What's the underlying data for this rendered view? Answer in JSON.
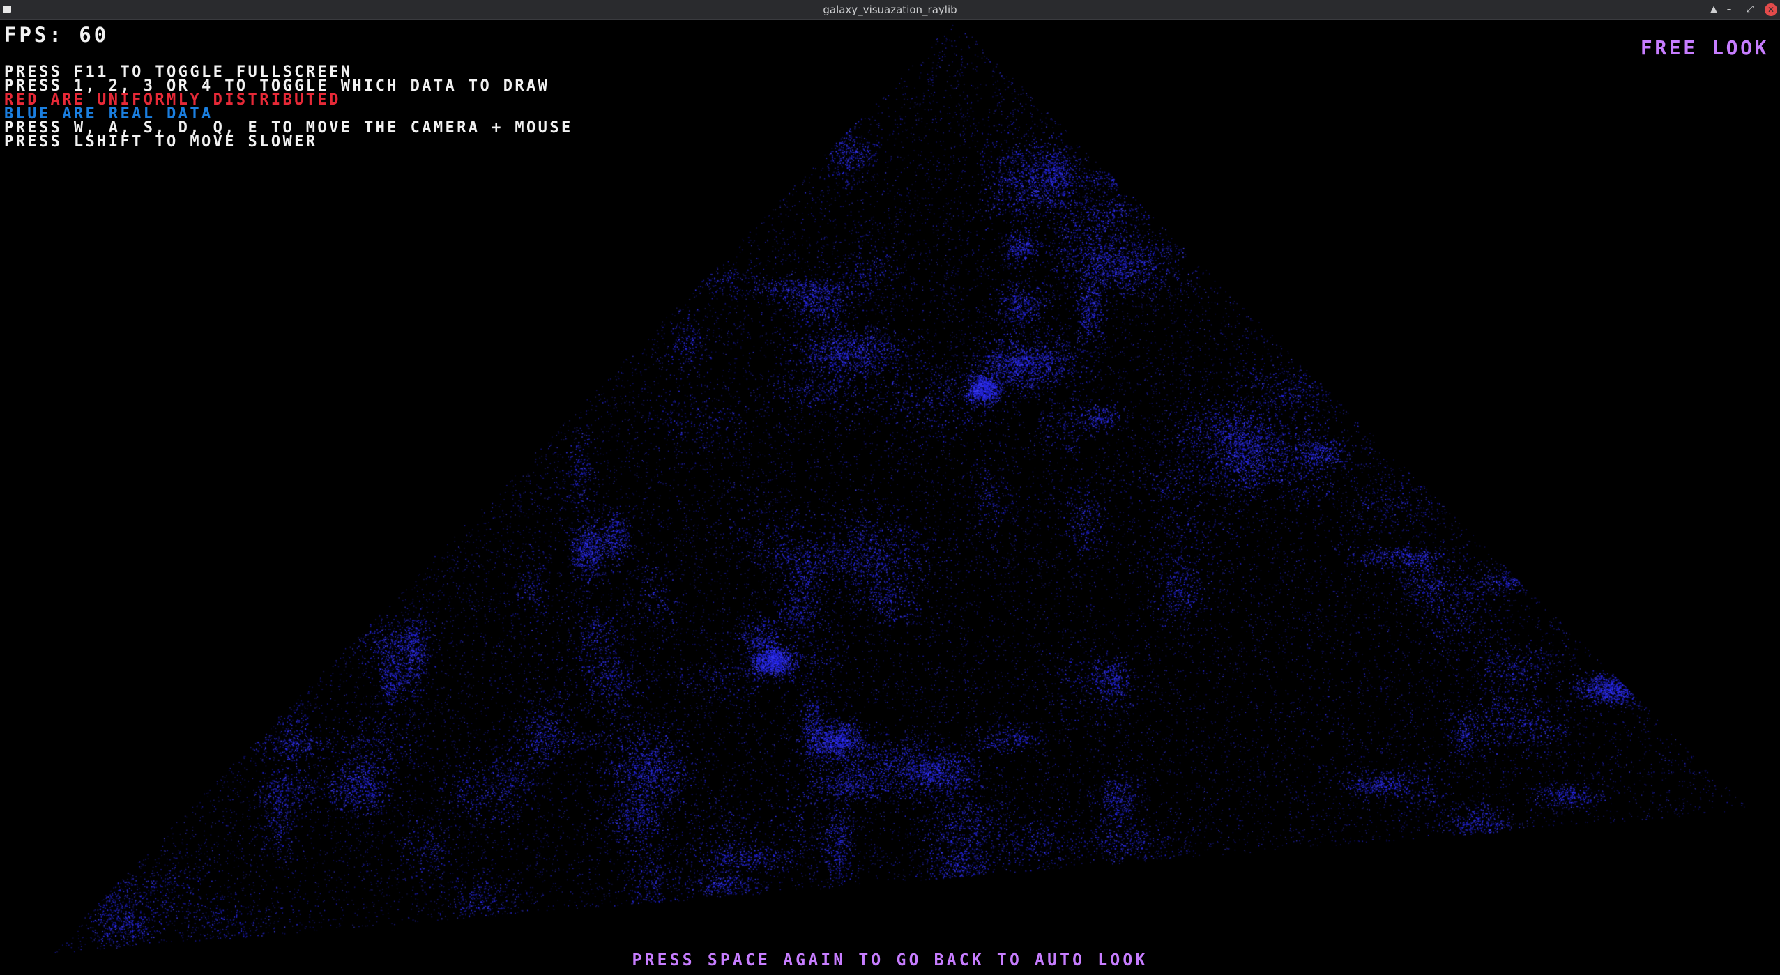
{
  "window": {
    "title": "galaxy_visuazation_raylib",
    "buttons": {
      "keep_above": "▲",
      "minimize": "–",
      "maximize": "⤢",
      "close": "✕"
    }
  },
  "hud": {
    "fps_label": "FPS: 60",
    "instructions": [
      {
        "text": "PRESS F11 TO TOGGLE FULLSCREEN",
        "color": "#f2f2f2"
      },
      {
        "text": "PRESS 1, 2, 3 OR 4 TO TOGGLE WHICH DATA TO DRAW",
        "color": "#f2f2f2"
      },
      {
        "text": "RED ARE UNIFORMLY DISTRIBUTED",
        "color": "#e62937"
      },
      {
        "text": "BLUE ARE REAL DATA",
        "color": "#1b7fe0"
      },
      {
        "text": "PRESS W, A, S, D, Q, E TO MOVE THE CAMERA + MOUSE",
        "color": "#f2f2f2"
      },
      {
        "text": "PRESS LSHIFT TO MOVE SLOWER",
        "color": "#f2f2f2"
      }
    ],
    "mode_label": "FREE LOOK",
    "footer_hint": "PRESS SPACE AGAIN TO GO BACK TO AUTO LOOK"
  },
  "scene": {
    "background_color": "#000000",
    "point_color": "#2a2cff",
    "accent_color": "#c77dff"
  }
}
